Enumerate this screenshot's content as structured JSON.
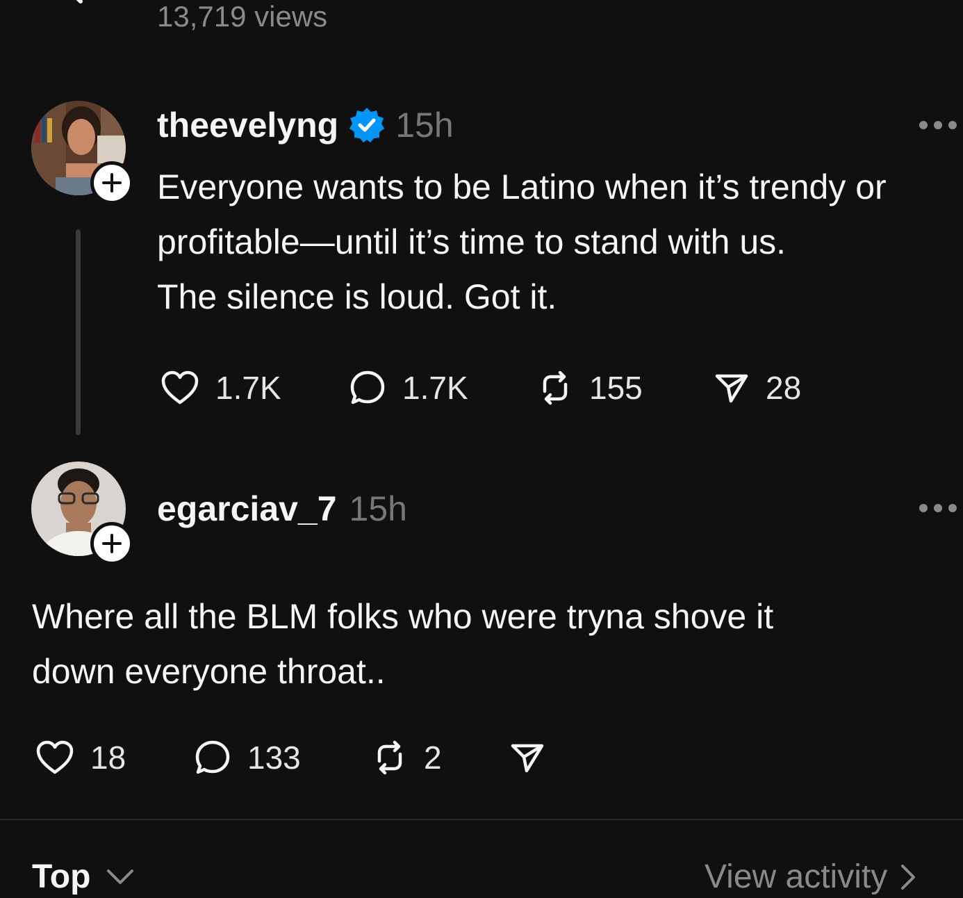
{
  "header": {
    "views": "13,719 views"
  },
  "posts": [
    {
      "username": "theevelyng",
      "verified": true,
      "time": "15h",
      "lines": [
        "Everyone wants to be Latino when it’s trendy or",
        "profitable—until it’s time to stand with us.",
        "The silence is loud. Got it."
      ],
      "likes": "1.7K",
      "replies": "1.7K",
      "reposts": "155",
      "shares": "28"
    },
    {
      "username": "egarciav_7",
      "verified": false,
      "time": "15h",
      "lines": [
        "Where all the BLM folks who were tryna shove it",
        "down everyone throat.."
      ],
      "likes": "18",
      "replies": "133",
      "reposts": "2",
      "shares": ""
    }
  ],
  "footer": {
    "sort_label": "Top",
    "activity_label": "View activity"
  },
  "colors": {
    "background": "#101010",
    "verified": "#0095f6",
    "muted": "#777777"
  }
}
